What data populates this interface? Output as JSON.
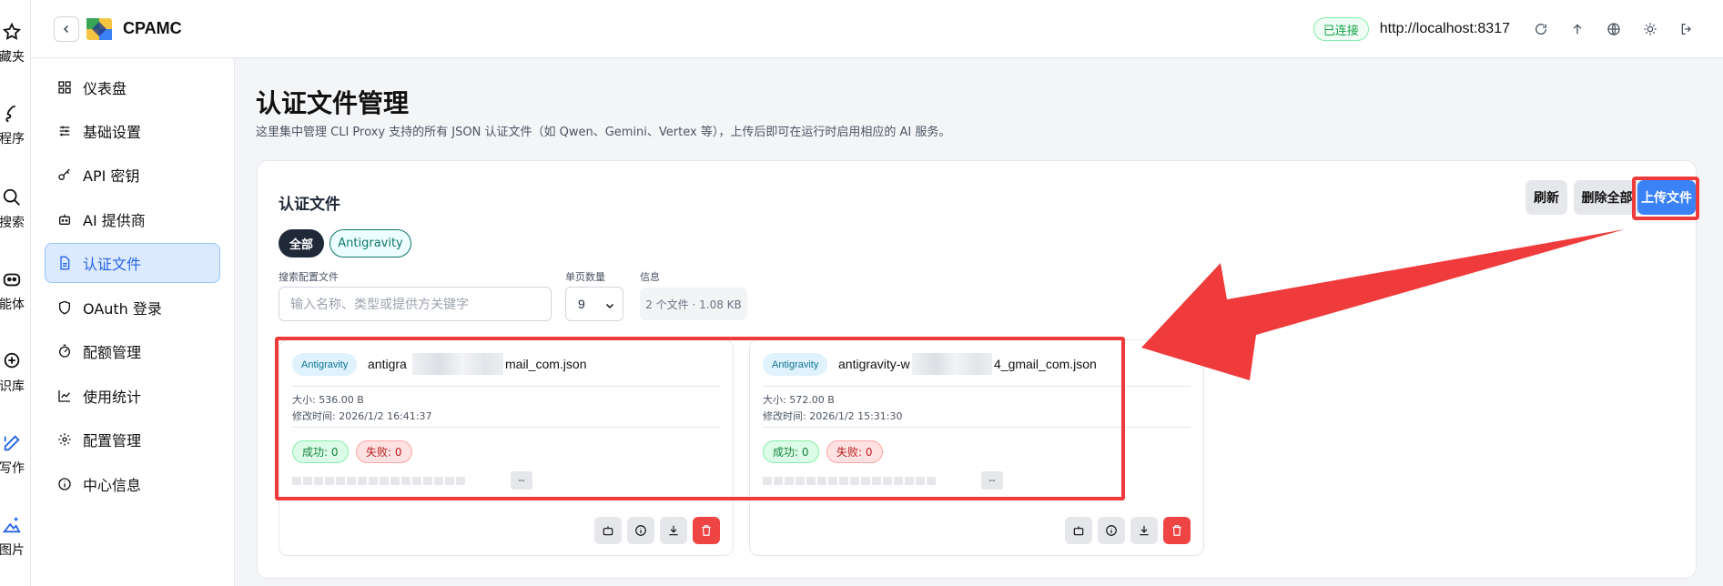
{
  "ext_strip": {
    "items": [
      {
        "label": "藏夹",
        "icon": "star-icon"
      },
      {
        "label": "程序",
        "icon": "script-icon"
      },
      {
        "label": "搜索",
        "icon": "search-icon"
      },
      {
        "label": "能体",
        "icon": "bot-icon"
      },
      {
        "label": "识库",
        "icon": "knowledge-icon"
      },
      {
        "label": "写作",
        "icon": "pen-icon"
      },
      {
        "label": "图片",
        "icon": "image-sparkle-icon"
      }
    ]
  },
  "header": {
    "brand": "CPAMC",
    "connection_status": "已连接",
    "host": "http://localhost:8317"
  },
  "sidebar": {
    "items": [
      {
        "label": "仪表盘",
        "icon": "dashboard-icon"
      },
      {
        "label": "基础设置",
        "icon": "sliders-icon"
      },
      {
        "label": "API 密钥",
        "icon": "key-icon"
      },
      {
        "label": "AI 提供商",
        "icon": "bot-icon"
      },
      {
        "label": "认证文件",
        "icon": "file-icon",
        "active": true
      },
      {
        "label": "OAuth 登录",
        "icon": "shield-icon"
      },
      {
        "label": "配额管理",
        "icon": "gauge-icon"
      },
      {
        "label": "使用统计",
        "icon": "chart-icon"
      },
      {
        "label": "配置管理",
        "icon": "settings-icon"
      },
      {
        "label": "中心信息",
        "icon": "info-icon"
      }
    ]
  },
  "main": {
    "title": "认证文件管理",
    "description": "这里集中管理 CLI Proxy 支持的所有 JSON 认证文件（如 Qwen、Gemini、Vertex 等），上传后即可在运行时启用相应的 AI 服务。",
    "card": {
      "title": "认证文件",
      "refresh_label": "刷新",
      "delete_all_label": "删除全部",
      "upload_label": "上传文件",
      "filters": [
        "全部",
        "Antigravity"
      ],
      "search_label": "搜索配置文件",
      "search_placeholder": "输入名称、类型或提供方关键字",
      "page_size_label": "单页数量",
      "page_size_value": "9",
      "info_label": "信息",
      "info_value": "2 个文件 · 1.08 KB"
    },
    "files": [
      {
        "type": "Antigravity",
        "name_prefix": "antigra",
        "name_suffix": "mail_com.json",
        "size": "大小: 536.00 B",
        "modified": "修改时间: 2026/1/2 16:41:37",
        "success": "成功: 0",
        "failure": "失败: 0",
        "dash": "--"
      },
      {
        "type": "Antigravity",
        "name_prefix": "antigravity-w",
        "name_suffix": "4_gmail_com.json",
        "size": "大小: 572.00 B",
        "modified": "修改时间: 2026/1/2 15:31:30",
        "success": "成功: 0",
        "failure": "失败: 0",
        "dash": "--"
      }
    ]
  },
  "colors": {
    "accent": "#3b82f6",
    "annotation_red": "#ef3b3b",
    "success": "#15803d",
    "danger": "#ef4444"
  }
}
